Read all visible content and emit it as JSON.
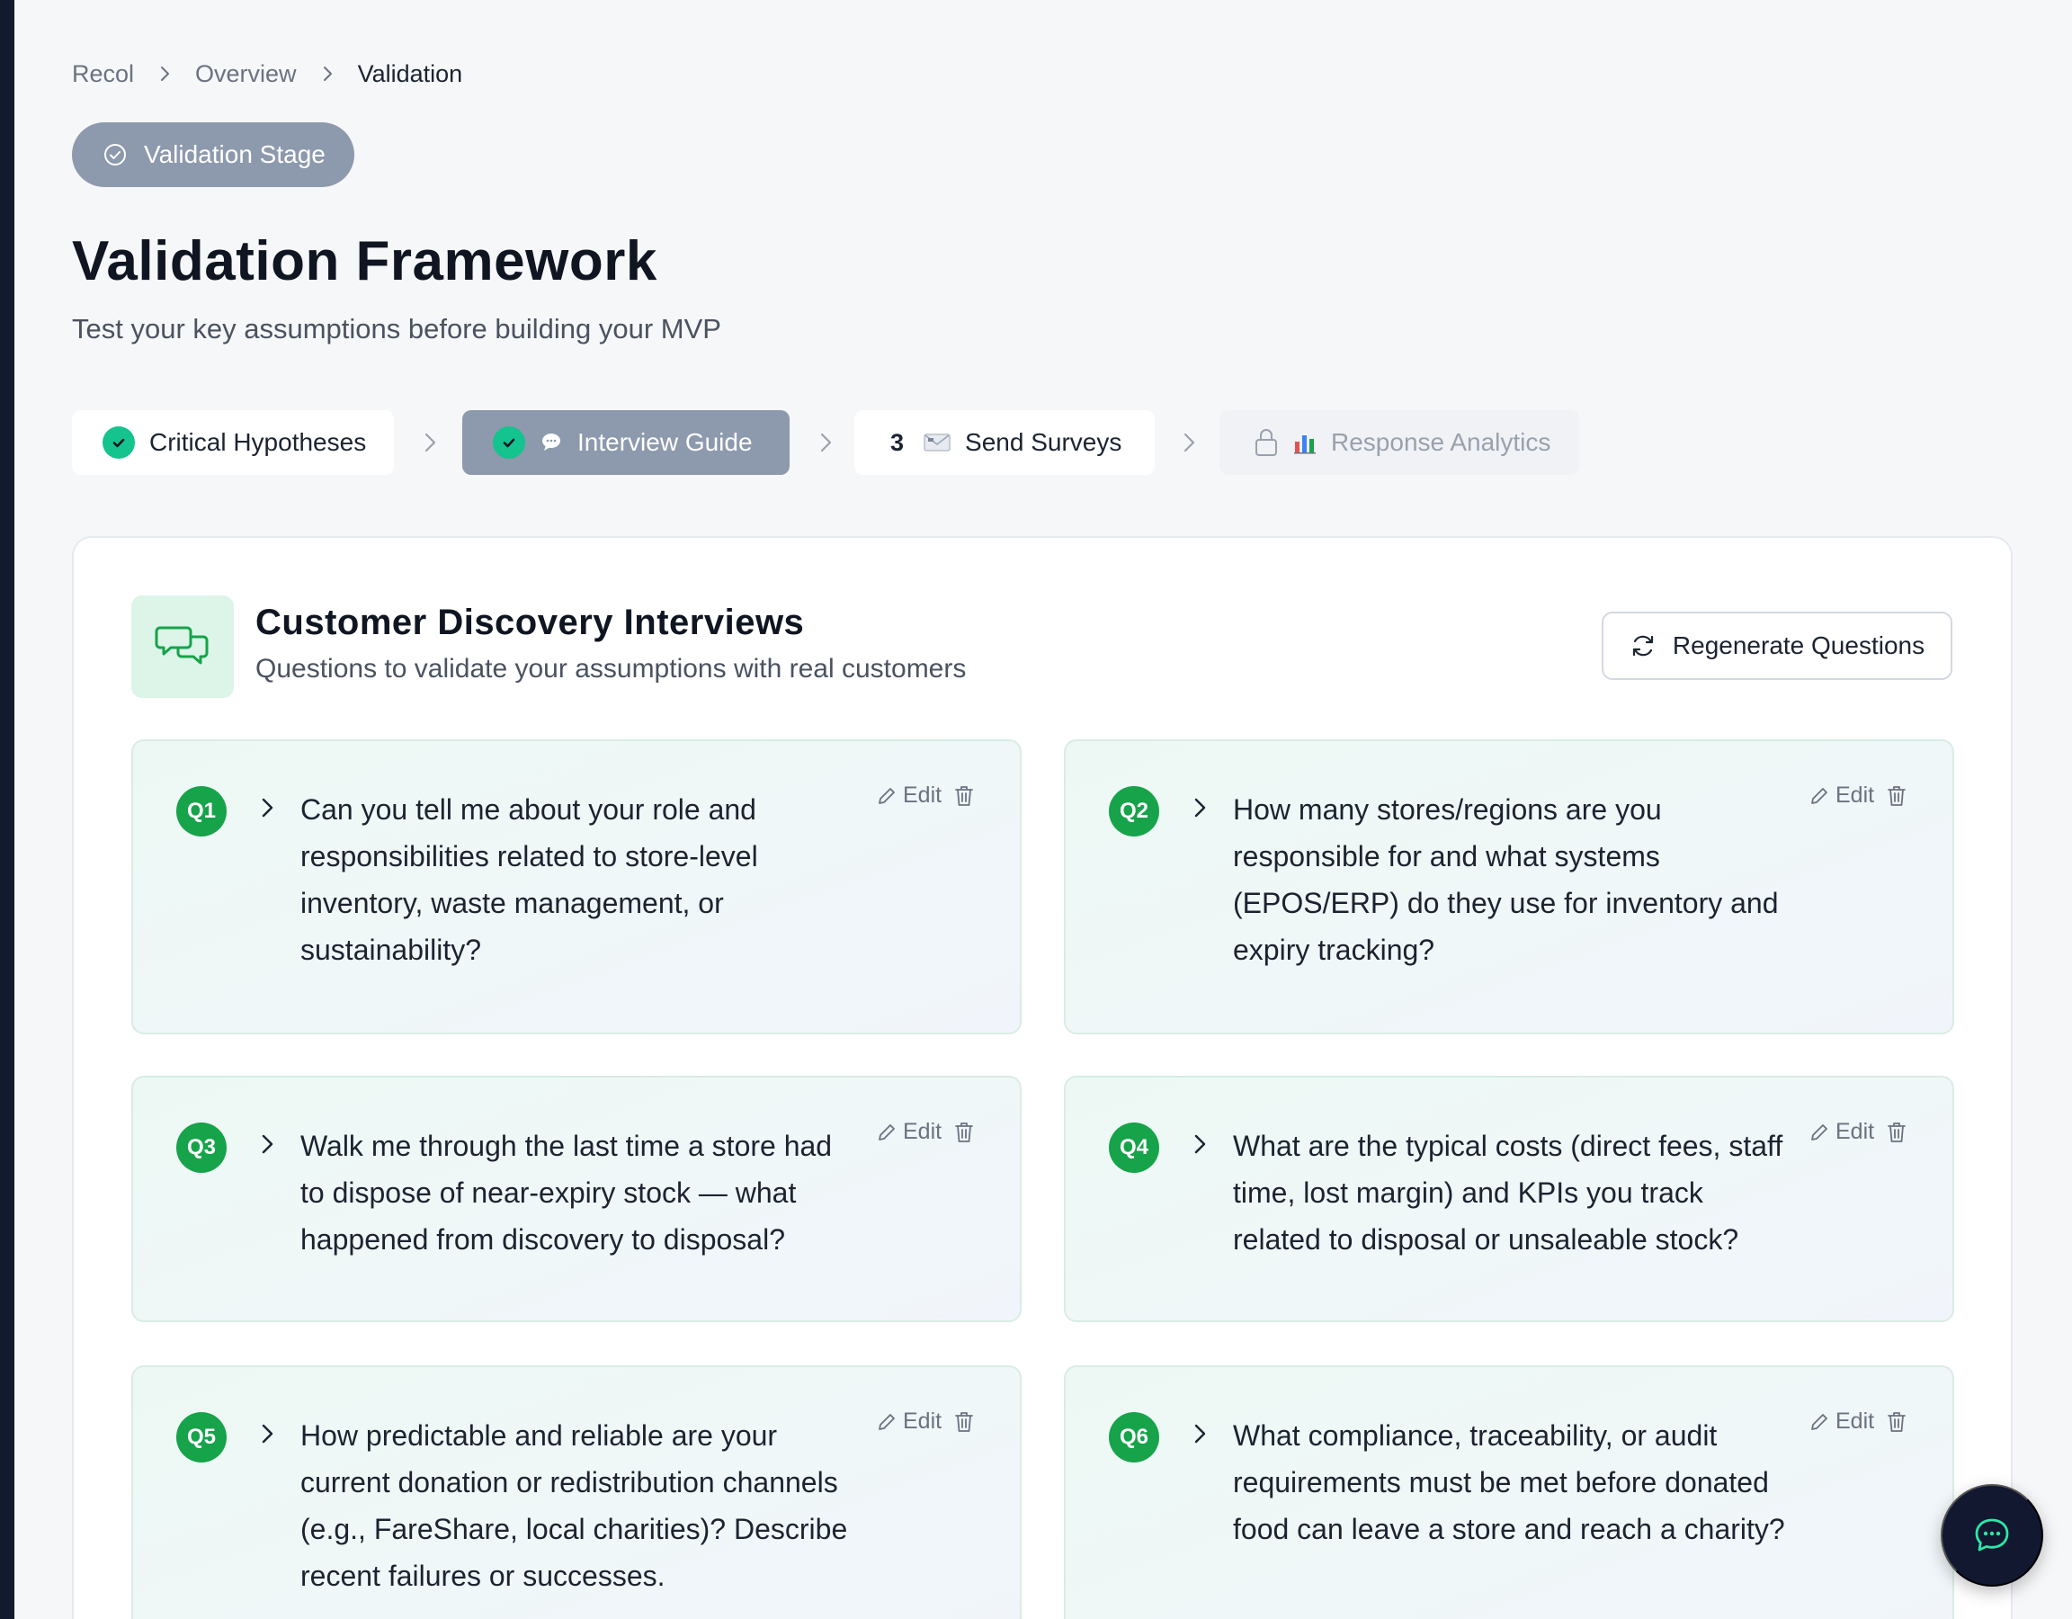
{
  "breadcrumb": {
    "items": [
      "Recol",
      "Overview",
      "Validation"
    ]
  },
  "stage_badge": {
    "label": "Validation Stage"
  },
  "page": {
    "title": "Validation Framework",
    "subtitle": "Test your key assumptions before building your MVP"
  },
  "steps": [
    {
      "label": "Critical Hypotheses",
      "state": "completed"
    },
    {
      "label": "Interview Guide",
      "state": "active",
      "icon": "speech-bubble-icon"
    },
    {
      "number": "3",
      "label": "Send Surveys",
      "state": "pending",
      "icon": "mail-icon"
    },
    {
      "label": "Response Analytics",
      "state": "locked",
      "icon": "bar-chart-icon"
    }
  ],
  "section": {
    "title": "Customer Discovery Interviews",
    "subtitle": "Questions to validate your assumptions with real customers",
    "regenerate_label": "Regenerate Questions"
  },
  "edit_label": "Edit",
  "questions": [
    {
      "id": "Q1",
      "text": "Can you tell me about your role and responsibilities related to store-level inventory, waste management, or sustainability?"
    },
    {
      "id": "Q2",
      "text": "How many stores/regions are you responsible for and what systems (EPOS/ERP) do they use for inventory and expiry tracking?"
    },
    {
      "id": "Q3",
      "text": "Walk me through the last time a store had to dispose of near-expiry stock — what happened from discovery to disposal?"
    },
    {
      "id": "Q4",
      "text": "What are the typical costs (direct fees, staff time, lost margin) and KPIs you track related to disposal or unsaleable stock?"
    },
    {
      "id": "Q5",
      "text": "How predictable and reliable are your current donation or redistribution channels (e.g., FareShare, local charities)? Describe recent failures or successes."
    },
    {
      "id": "Q6",
      "text": "What compliance, traceability, or audit requirements must be met before donated food can leave a store and reach a charity?"
    }
  ],
  "colors": {
    "accent_green": "#16a34a",
    "check_green": "#14c38e",
    "active_step": "#8d99ac",
    "fab": "#111830"
  }
}
